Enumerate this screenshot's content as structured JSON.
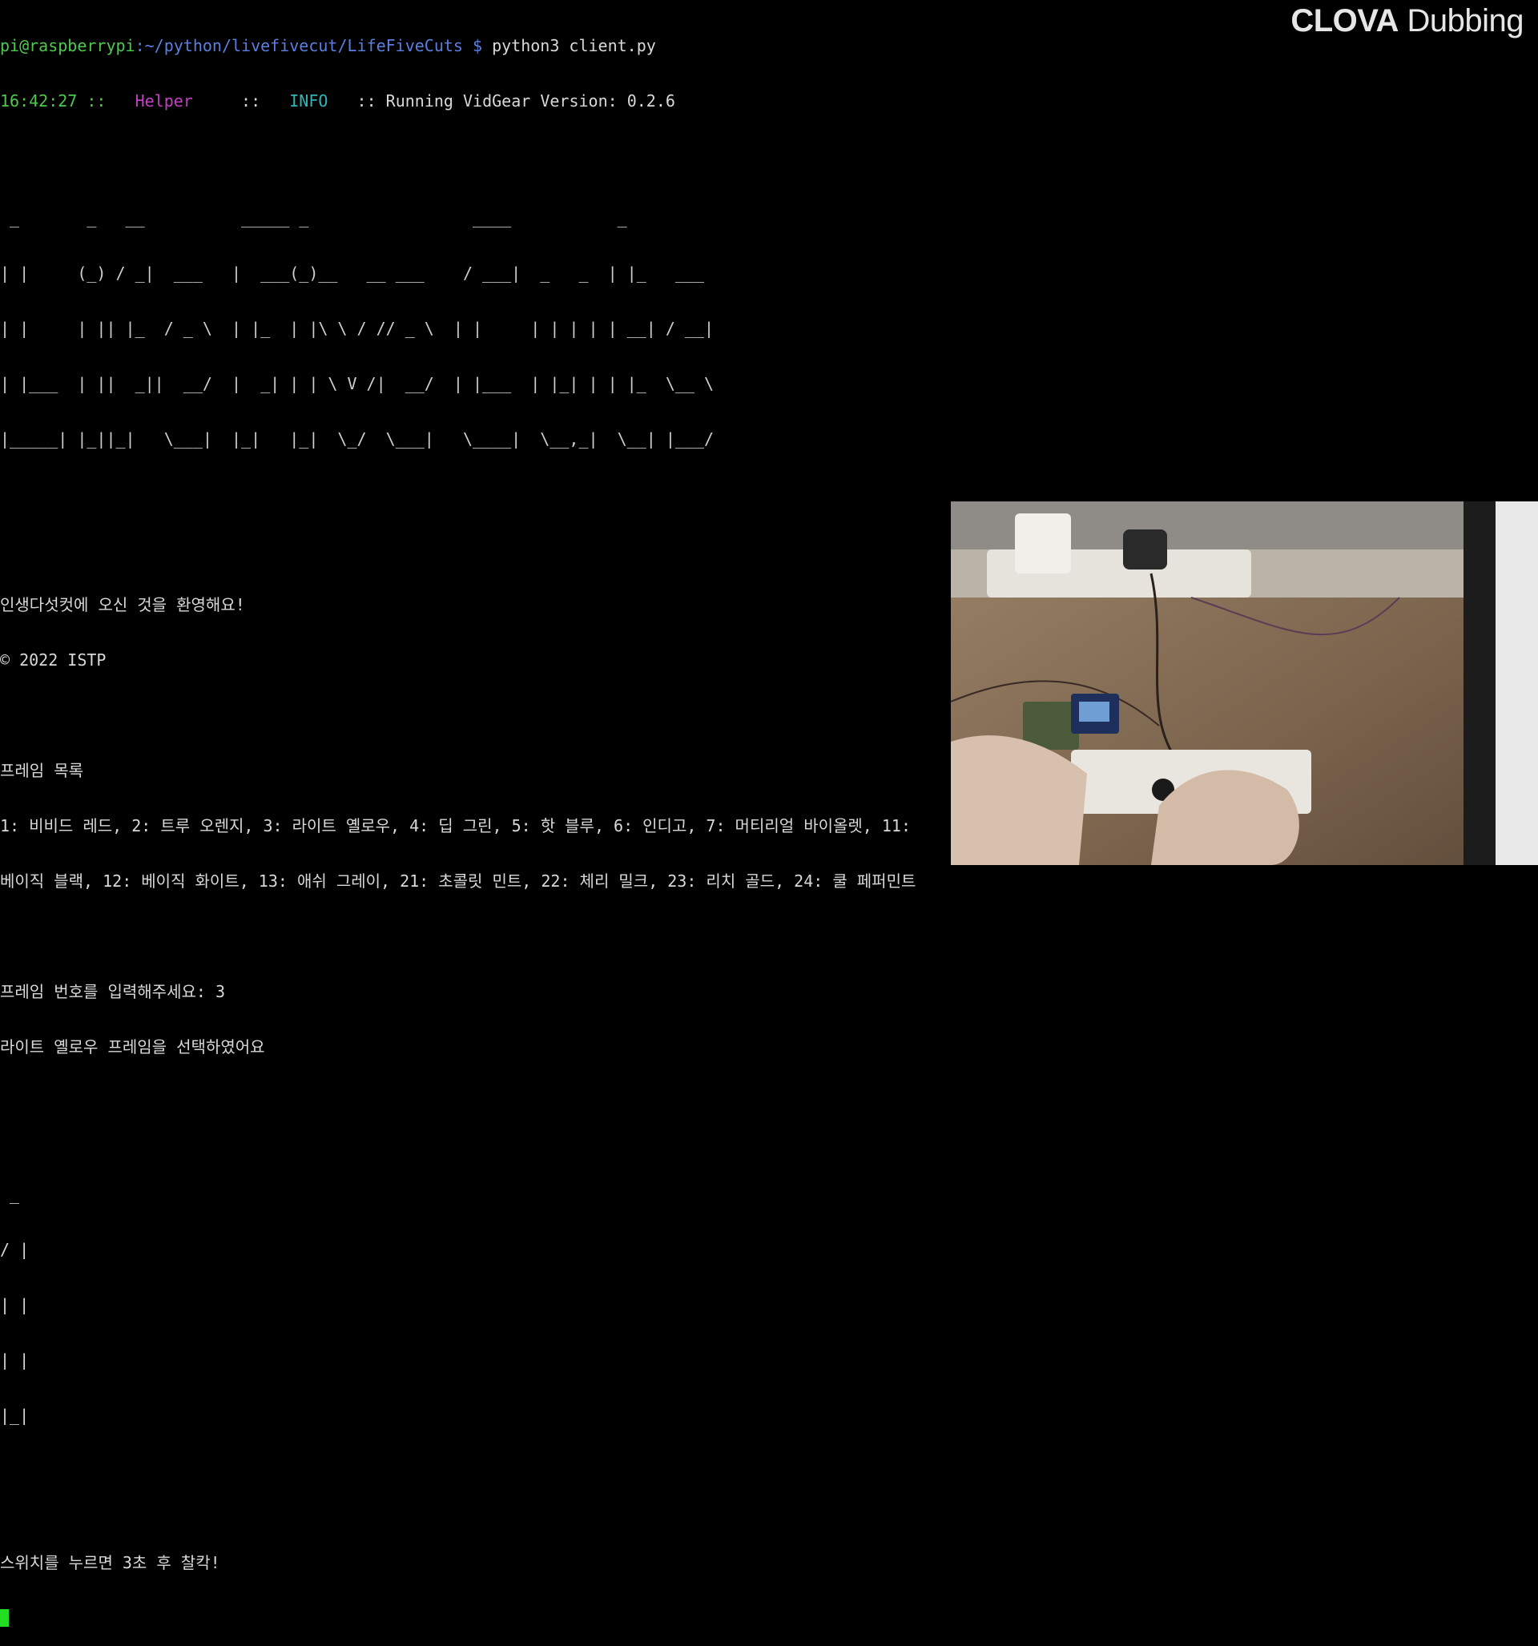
{
  "watermark": {
    "brand": "CLOVA",
    "product": "Dubbing"
  },
  "prompt": {
    "user_host": "pi@raspberrypi",
    "path": ":~/python/livefivecut/LifeFiveCuts $",
    "command": " python3 client.py"
  },
  "log": {
    "time": "16:42:27",
    "sep1": " ::   ",
    "source": "Helper",
    "sep2": "     ::   ",
    "level": "INFO",
    "sep3": "   :: ",
    "message": "Running VidGear Version: 0.2.6"
  },
  "banner_art": [
    " _       _   __          _____ _                 ____           _          ",
    "| |     (_) / _|  ___   |  ___(_)__   __ ___    / ___|  _   _  | |_   ___  ",
    "| |     | || |_  / _ \\  | |_  | |\\ \\ / // _ \\  | |     | | | | | __| / __| ",
    "| |___  | ||  _||  __/  |  _| | | \\ V /|  __/  | |___  | |_| | | |_  \\__ \\ ",
    "|_____| |_||_|   \\___|  |_|   |_|  \\_/  \\___|   \\____|  \\__,_|  \\__| |___/ "
  ],
  "welcome": "인생다섯컷에 오신 것을 환영해요!",
  "copyright": "© 2022 ISTP",
  "frames_title": "프레임 목록",
  "frames_line1": "1: 비비드 레드, 2: 트루 오렌지, 3: 라이트 옐로우, 4: 딥 그린, 5: 핫 블루, 6: 인디고, 7: 머티리얼 바이올렛, 11:",
  "frames_line2": "베이직 블랙, 12: 베이직 화이트, 13: 애쉬 그레이, 21: 초콜릿 민트, 22: 체리 밀크, 23: 리치 골드, 24: 쿨 페퍼민트",
  "input_prompt": "프레임 번호를 입력해주세요: 3",
  "selected": "라이트 옐로우 프레임을 선택하였어요",
  "countdown_art": [
    " _ ",
    "/ |",
    "| |",
    "| |",
    "|_|"
  ],
  "instruction": "스위치를 누르면 3초 후 찰칵!"
}
